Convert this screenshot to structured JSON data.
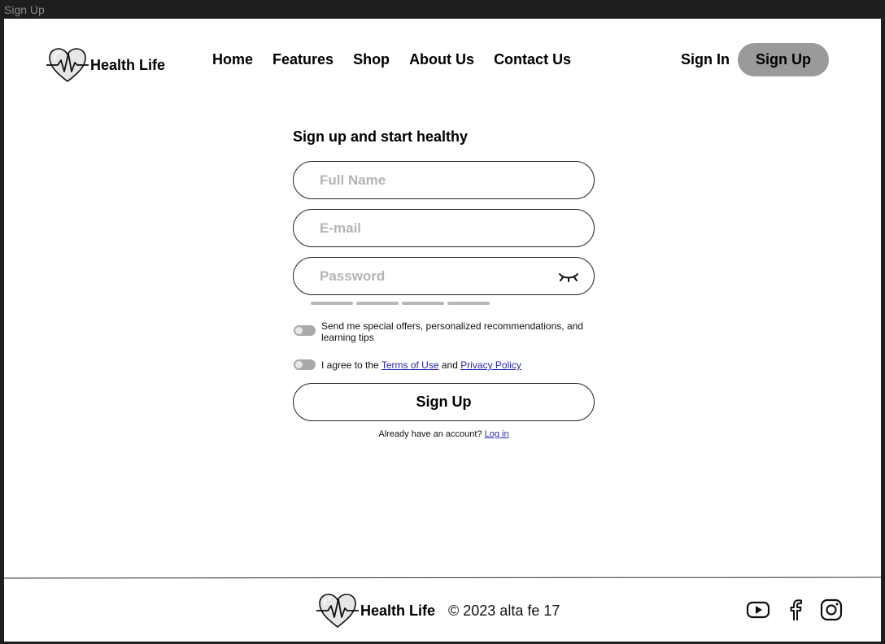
{
  "window": {
    "title": "Sign Up"
  },
  "brand": {
    "name": "Health Life",
    "logo_icon": "heart-pulse-icon"
  },
  "nav": {
    "items": [
      {
        "label": "Home"
      },
      {
        "label": "Features"
      },
      {
        "label": "Shop"
      },
      {
        "label": "About Us"
      },
      {
        "label": "Contact Us"
      }
    ]
  },
  "auth": {
    "signin_label": "Sign In",
    "signup_label": "Sign Up"
  },
  "form": {
    "title": "Sign up and start healthy",
    "full_name": {
      "placeholder": "Full Name",
      "value": ""
    },
    "email": {
      "placeholder": "E-mail",
      "value": ""
    },
    "password": {
      "placeholder": "Password",
      "value": "",
      "toggle_icon": "eye-closed-icon"
    },
    "strength_segments": 4,
    "offers_text": "Send me special offers, personalized recommendations, and learning tips",
    "offers_enabled": false,
    "agree_prefix": "I agree to the",
    "terms_label": "Terms of Use",
    "agree_and": "and",
    "privacy_label": "Privacy Policy",
    "agree_enabled": false,
    "submit_label": "Sign Up",
    "already_text": "Already have an account?",
    "login_label": "Log in"
  },
  "footer": {
    "brand": "Health Life",
    "copyright": "© 2023 alta fe 17",
    "social": [
      {
        "icon": "youtube-icon"
      },
      {
        "icon": "facebook-icon"
      },
      {
        "icon": "instagram-icon"
      }
    ]
  },
  "colors": {
    "accent_button": "#9a9a9a",
    "placeholder": "#b4b4b4",
    "link": "#2a2aaa",
    "toggle_off": "#a9a9a9",
    "strength_bar": "#b8b8b8"
  }
}
